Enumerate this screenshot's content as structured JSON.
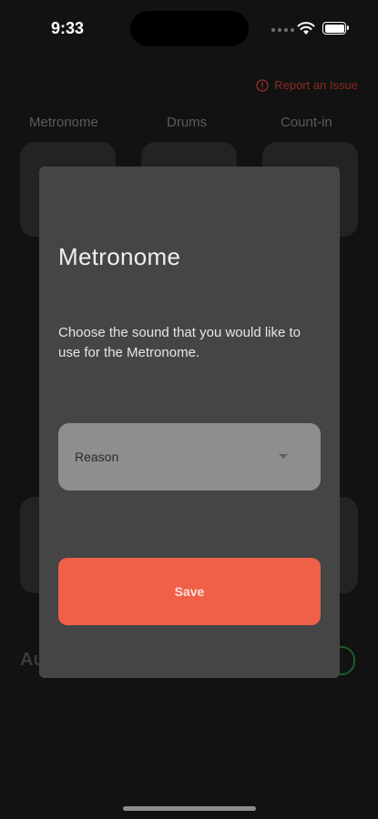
{
  "status_bar": {
    "time": "9:33"
  },
  "header": {
    "report_label": "Report an Issue",
    "report_color": "#8c2b21"
  },
  "tabs": [
    {
      "label": "Metronome"
    },
    {
      "label": "Drums"
    },
    {
      "label": "Count-in"
    }
  ],
  "background": {
    "partial_label": "Au"
  },
  "modal": {
    "title": "Metronome",
    "description": "Choose the sound that you would like to use for the Metronome.",
    "select": {
      "value": "Reason"
    },
    "save_label": "Save",
    "accent_color": "#f06048"
  }
}
